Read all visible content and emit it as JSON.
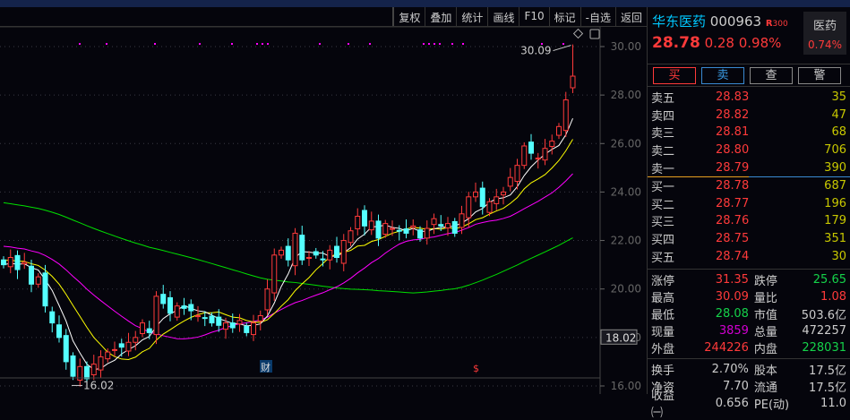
{
  "toolbar": [
    "复权",
    "叠加",
    "统计",
    "画线",
    "F10",
    "标记",
    "-自选",
    "返回"
  ],
  "stock": {
    "name": "华东医药",
    "code": "000963",
    "badge": "R",
    "badge2": "300",
    "price": "28.78",
    "change": "0.28",
    "pct": "0.98%",
    "sector": "医药",
    "sector_pct": "0.74%"
  },
  "actions": [
    "买",
    "卖",
    "查",
    "警"
  ],
  "asks": [
    {
      "l": "卖五",
      "p": "28.83",
      "v": "35"
    },
    {
      "l": "卖四",
      "p": "28.82",
      "v": "47"
    },
    {
      "l": "卖三",
      "p": "28.81",
      "v": "68"
    },
    {
      "l": "卖二",
      "p": "28.80",
      "v": "706"
    },
    {
      "l": "卖一",
      "p": "28.79",
      "v": "390"
    }
  ],
  "bids": [
    {
      "l": "买一",
      "p": "28.78",
      "v": "687"
    },
    {
      "l": "买二",
      "p": "28.77",
      "v": "196"
    },
    {
      "l": "买三",
      "p": "28.76",
      "v": "179"
    },
    {
      "l": "买四",
      "p": "28.75",
      "v": "351"
    },
    {
      "l": "买五",
      "p": "28.74",
      "v": "30"
    }
  ],
  "stats": [
    [
      {
        "l": "涨停",
        "v": "31.35",
        "c": "red"
      },
      {
        "l": "跌停",
        "v": "25.65",
        "c": "grn"
      }
    ],
    [
      {
        "l": "最高",
        "v": "30.09",
        "c": "red"
      },
      {
        "l": "量比",
        "v": "1.08",
        "c": "red"
      }
    ],
    [
      {
        "l": "最低",
        "v": "28.08",
        "c": "grn"
      },
      {
        "l": "市值",
        "v": "503.6亿",
        "c": "wht"
      }
    ],
    [
      {
        "l": "现量",
        "v": "3859",
        "c": "mag"
      },
      {
        "l": "总量",
        "v": "472257",
        "c": "wht"
      }
    ],
    [
      {
        "l": "外盘",
        "v": "244226",
        "c": "red"
      },
      {
        "l": "内盘",
        "v": "228031",
        "c": "grn"
      }
    ]
  ],
  "stats2": [
    [
      {
        "l": "换手",
        "v": "2.70%"
      },
      {
        "l": "股本",
        "v": "17.5亿"
      }
    ],
    [
      {
        "l": "净资",
        "v": "7.70"
      },
      {
        "l": "流通",
        "v": "17.5亿"
      }
    ],
    [
      {
        "l": "收益㈠",
        "v": "0.656"
      },
      {
        "l": "PE(动)",
        "v": "11.0"
      }
    ]
  ],
  "chart_data": {
    "type": "candlestick",
    "y_ticks": [
      "30.00",
      "28.00",
      "26.00",
      "24.00",
      "22.00",
      "20.00",
      "18.00",
      "16.00"
    ],
    "ylim": [
      16,
      30
    ],
    "current_label": "18.02",
    "high_label": "30.09",
    "low_label": "16.02",
    "markers": [
      "财",
      "$"
    ],
    "closes": [
      21.0,
      21.3,
      20.8,
      21.1,
      20.2,
      20.5,
      19.3,
      18.6,
      18.0,
      17.0,
      16.4,
      16.8,
      16.3,
      16.9,
      17.2,
      17.4,
      17.5,
      17.6,
      17.8,
      18.0,
      18.6,
      18.2,
      19.7,
      19.4,
      19.0,
      19.3,
      19.2,
      19.1,
      18.9,
      18.8,
      18.6,
      18.5,
      18.6,
      18.4,
      18.7,
      18.2,
      18.6,
      18.9,
      20.0,
      21.4,
      21.6,
      21.2,
      22.3,
      21.2,
      21.3,
      21.4,
      21.2,
      21.6,
      21.3,
      22.0,
      22.4,
      23.0,
      22.6,
      22.8,
      22.1,
      22.7,
      22.5,
      22.4,
      22.3,
      22.6,
      22.1,
      22.5,
      22.9,
      22.6,
      22.7,
      22.3,
      23.1,
      23.8,
      24.0,
      23.4,
      23.6,
      23.8,
      24.0,
      24.6,
      25.1,
      25.9,
      25.6,
      25.4,
      25.8,
      26.1,
      26.7,
      27.8,
      28.78
    ],
    "last_high": 30.09,
    "ma_colors": {
      "ma5": "#ffffff",
      "ma10": "#ffff00",
      "ma20": "#ff00ff",
      "ma60": "#00e000"
    },
    "up_color": "#ff3a3a",
    "down_color": "#54ffff"
  }
}
